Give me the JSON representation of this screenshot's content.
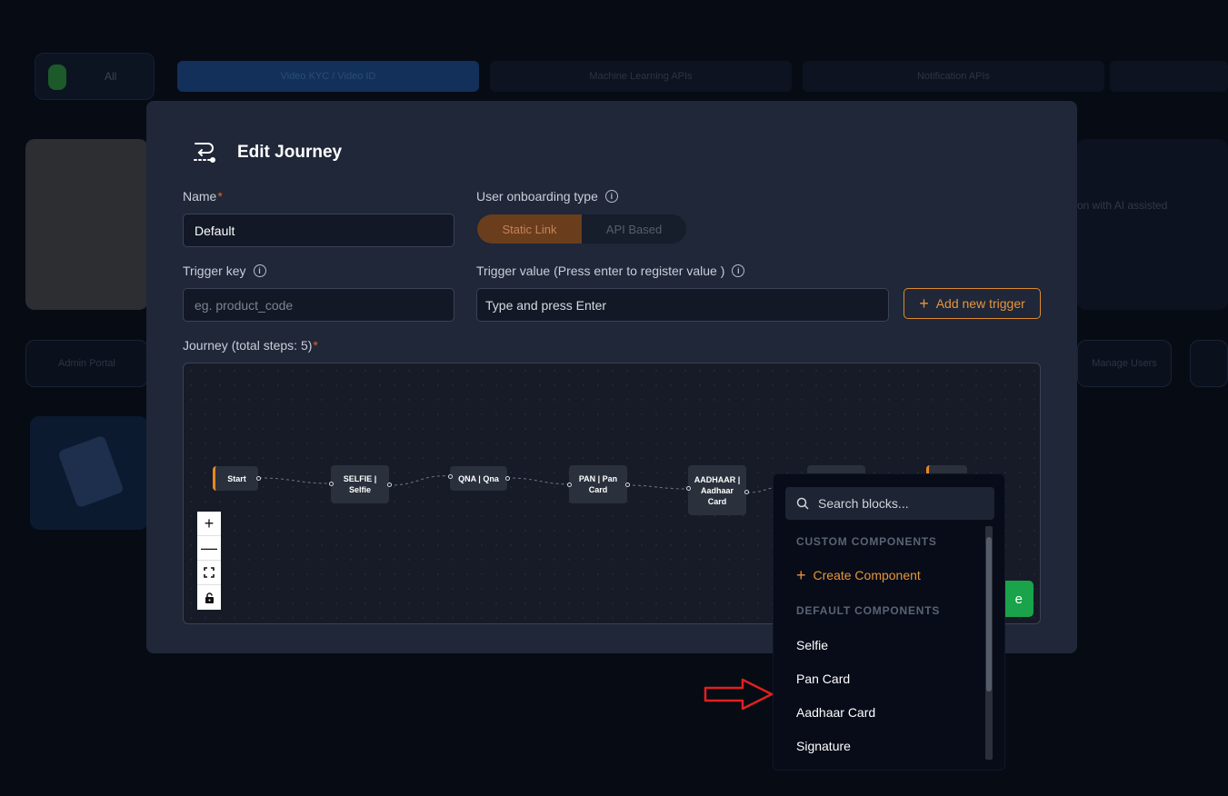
{
  "background": {
    "toggle_label": "All",
    "tabs": [
      "Video KYC / Video ID",
      "Machine Learning APIs",
      "Notification APIs"
    ],
    "right_text": "on with AI assisted",
    "buttons": [
      "Admin Portal",
      "Manage Users"
    ]
  },
  "modal": {
    "title": "Edit Journey",
    "name_label": "Name",
    "name_value": "Default",
    "onboarding_label": "User onboarding type",
    "onboarding_options": [
      "Static Link",
      "API Based"
    ],
    "trigger_key_label": "Trigger key",
    "trigger_key_placeholder": "eg. product_code",
    "trigger_value_label": "Trigger value (Press enter to register value )",
    "trigger_value_placeholder": "Type and press Enter",
    "add_trigger_label": "Add new trigger",
    "journey_label": "Journey (total steps: 5)",
    "save_label": "e"
  },
  "journey_nodes": [
    {
      "label": "Start"
    },
    {
      "label": "SELFIE | Selfie"
    },
    {
      "label": "QNA | Qna"
    },
    {
      "label": "PAN | Pan Card"
    },
    {
      "label": "AADHAAR | Aadhaar Card"
    }
  ],
  "zoom_controls": [
    "+",
    "—",
    "⛶",
    "🔓"
  ],
  "dropdown": {
    "search_placeholder": "Search blocks...",
    "custom_heading": "CUSTOM COMPONENTS",
    "create_label": "Create Component",
    "default_heading": "DEFAULT COMPONENTS",
    "items": [
      "Selfie",
      "Pan Card",
      "Aadhaar Card",
      "Signature"
    ]
  },
  "colors": {
    "accent": "#e8953a",
    "success": "#1aa34a",
    "modal_bg": "#1f2738",
    "arrow": "#e02020"
  }
}
